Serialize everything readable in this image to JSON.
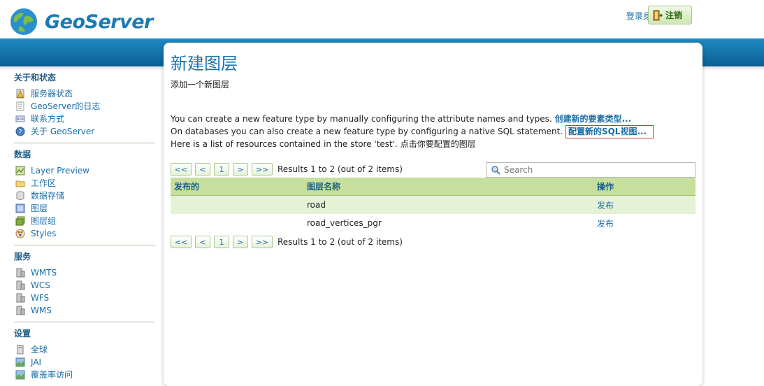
{
  "header": {
    "logo_text": "GeoServer",
    "login_text": "登录身份 admin.",
    "logout_label": "注销"
  },
  "sidebar": {
    "sections": [
      {
        "title": "关于和状态",
        "items": [
          {
            "label": "服务器状态",
            "icon": "server-status-icon"
          },
          {
            "label": "GeoServer的日志",
            "icon": "log-icon"
          },
          {
            "label": "联系方式",
            "icon": "contact-icon"
          },
          {
            "label": "关于 GeoServer",
            "icon": "about-icon"
          }
        ]
      },
      {
        "title": "数据",
        "items": [
          {
            "label": "Layer Preview",
            "icon": "layer-preview-icon"
          },
          {
            "label": "工作区",
            "icon": "workspace-icon"
          },
          {
            "label": "数据存储",
            "icon": "store-icon"
          },
          {
            "label": "图层",
            "icon": "layer-icon"
          },
          {
            "label": "图层组",
            "icon": "layer-group-icon"
          },
          {
            "label": "Styles",
            "icon": "styles-icon"
          }
        ]
      },
      {
        "title": "服务",
        "items": [
          {
            "label": "WMTS",
            "icon": "service-icon"
          },
          {
            "label": "WCS",
            "icon": "service-icon"
          },
          {
            "label": "WFS",
            "icon": "service-icon"
          },
          {
            "label": "WMS",
            "icon": "service-icon"
          }
        ]
      },
      {
        "title": "设置",
        "items": [
          {
            "label": "全球",
            "icon": "global-settings-icon"
          },
          {
            "label": "JAI",
            "icon": "jai-icon"
          },
          {
            "label": "覆盖率访问",
            "icon": "coverage-access-icon"
          }
        ]
      }
    ]
  },
  "main": {
    "title": "新建图层",
    "subtitle": "添加一个新图层",
    "line1_text": "You can create a new feature type by manually configuring the attribute names and types. ",
    "line1_link": "创建新的要素类型...",
    "line2_text": "On databases you can also create a new feature type by configuring a native SQL statement. ",
    "line2_link": "配置新的SQL视图...",
    "line3_text": "Here is a list of resources contained in the store 'test'. 点击你要配置的图层",
    "pager": {
      "first": "<<",
      "prev": "<",
      "page": "1",
      "next": ">",
      "last": ">>",
      "results": "Results 1 to 2 (out of 2 items)"
    },
    "search_placeholder": "Search",
    "table": {
      "headers": [
        "发布的",
        "图层名称",
        "操作"
      ],
      "rows": [
        {
          "published": "",
          "name": "road",
          "action": "发布"
        },
        {
          "published": "",
          "name": "road_vertices_pgr",
          "action": "发布"
        }
      ]
    }
  },
  "colors": {
    "accent_blue": "#1a6ea8",
    "band_blue": "#0a5e93",
    "table_header_green": "#c7df9d",
    "row_alt_green": "#e5f2d5",
    "highlight_red": "#d23b3b"
  }
}
